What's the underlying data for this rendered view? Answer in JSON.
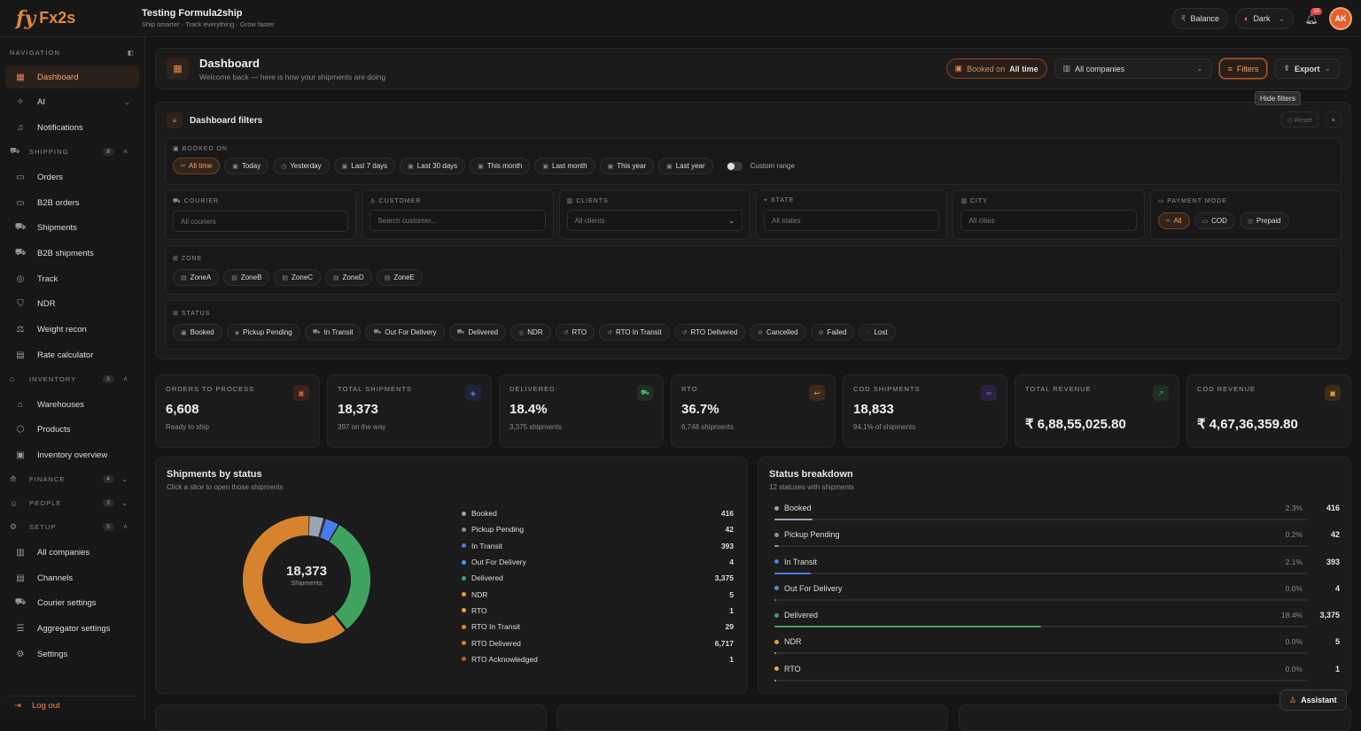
{
  "brand": {
    "logo": "fy",
    "logo2": "Fx2s",
    "title": "Testing Formula2ship",
    "subtitle": "Ship smarter · Track everything · Grow faster"
  },
  "topbar": {
    "balance": "Balance",
    "theme": "Dark",
    "notif_count": "10",
    "avatar": "AK"
  },
  "nav": {
    "header": "NAVIGATION",
    "top": [
      {
        "label": "Dashboard",
        "icon": "dashboard-icon",
        "active": true
      },
      {
        "label": "AI",
        "icon": "ai-icon",
        "chev": "⌄"
      },
      {
        "label": "Notifications",
        "icon": "bell-icon"
      }
    ],
    "shipping": {
      "label": "SHIPPING",
      "count": "8",
      "items": [
        "Orders",
        "B2B orders",
        "Shipments",
        "B2B shipments",
        "Track",
        "NDR",
        "Weight recon",
        "Rate calculator"
      ]
    },
    "inventory": {
      "label": "INVENTORY",
      "count": "3",
      "items": [
        "Warehouses",
        "Products",
        "Inventory overview"
      ]
    },
    "finance": {
      "label": "FINANCE",
      "count": "4"
    },
    "people": {
      "label": "PEOPLE",
      "count": "3"
    },
    "setup": {
      "label": "SETUP",
      "count": "5",
      "items": [
        "All companies",
        "Channels",
        "Courier settings",
        "Aggregator settings",
        "Settings"
      ]
    },
    "logout": "Log out"
  },
  "header": {
    "title": "Dashboard",
    "subtitle": "Welcome back — here is how your shipments are doing",
    "booked_key": "Booked on",
    "booked_val": "All time",
    "companies": "All companies",
    "filters": "Filters",
    "export": "Export",
    "tooltip": "Hide filters"
  },
  "filters": {
    "title": "Dashboard filters",
    "reset": "Reset",
    "booked_label": "BOOKED ON",
    "booked": [
      "All time",
      "Today",
      "Yesterday",
      "Last 7 days",
      "Last 30 days",
      "This month",
      "Last month",
      "This year",
      "Last year"
    ],
    "custom": "Custom range",
    "courier_label": "COURIER",
    "courier_ph": "All couriers",
    "customer_label": "CUSTOMER",
    "customer_ph": "Search customer...",
    "clients_label": "CLIENTS",
    "clients_ph": "All clients",
    "state_label": "STATE",
    "state_ph": "All states",
    "city_label": "CITY",
    "city_ph": "All cities",
    "payment_label": "PAYMENT MODE",
    "payment": [
      "All",
      "COD",
      "Prepaid"
    ],
    "zone_label": "ZONE",
    "zones": [
      "ZoneA",
      "ZoneB",
      "ZoneC",
      "ZoneD",
      "ZoneE"
    ],
    "status_label": "STATUS",
    "statuses": [
      "Booked",
      "Pickup Pending",
      "In Transit",
      "Out For Delivery",
      "Delivered",
      "NDR",
      "RTO",
      "RTO In Transit",
      "RTO Delivered",
      "Cancelled",
      "Failed",
      "Lost"
    ]
  },
  "stats": [
    {
      "label": "ORDERS TO PROCESS",
      "value": "6,608",
      "sub": "Ready to ship",
      "color": "#d45a3a",
      "bg": "#3a221c"
    },
    {
      "label": "TOTAL SHIPMENTS",
      "value": "18,373",
      "sub": "397 on the way",
      "color": "#5b7ee8",
      "bg": "#1e253a"
    },
    {
      "label": "DELIVERED",
      "value": "18.4%",
      "sub": "3,375 shipments",
      "color": "#4caf6a",
      "bg": "#1d2e22"
    },
    {
      "label": "RTO",
      "value": "36.7%",
      "sub": "6,748 shipments",
      "color": "#e0a23a",
      "bg": "#3a2c18"
    },
    {
      "label": "COD SHIPMENTS",
      "value": "18,833",
      "sub": "94.1% of shipments",
      "color": "#9a6ae8",
      "bg": "#2a2140"
    },
    {
      "label": "TOTAL REVENUE",
      "value": "₹ 6,88,55,025.80",
      "sub": "",
      "color": "#4caf6a",
      "bg": "#1d2e22"
    },
    {
      "label": "COD REVENUE",
      "value": "₹ 4,67,36,359.80",
      "sub": "",
      "color": "#e0a23a",
      "bg": "#3a2c18"
    }
  ],
  "donut": {
    "title": "Shipments by status",
    "subtitle": "Click a slice to open those shipments",
    "total": "18,373",
    "total_label": "Shipments"
  },
  "chart_data": {
    "type": "pie",
    "categories": [
      "Booked",
      "Pickup Pending",
      "In Transit",
      "Out For Delivery",
      "Delivered",
      "NDR",
      "RTO",
      "RTO In Transit",
      "RTO Delivered",
      "RTO Acknowledged"
    ],
    "values": [
      416,
      42,
      393,
      4,
      3375,
      5,
      1,
      29,
      6717,
      1
    ],
    "colors": [
      "#9aa3b0",
      "#8a8f99",
      "#4a7be8",
      "#3d9ae0",
      "#3fa35f",
      "#e0a23a",
      "#e8a63a",
      "#d08a30",
      "#d6822f",
      "#c2532c"
    ]
  },
  "breakdown": {
    "title": "Status breakdown",
    "subtitle": "12 statuses with shipments",
    "rows": [
      {
        "label": "Booked",
        "pct": "2.3%",
        "count": "416",
        "color": "#9aa3b0",
        "fill": 0.072
      },
      {
        "label": "Pickup Pending",
        "pct": "0.2%",
        "count": "42",
        "color": "#8a8f99",
        "fill": 0.008
      },
      {
        "label": "In Transit",
        "pct": "2.1%",
        "count": "393",
        "color": "#4a7be8",
        "fill": 0.068
      },
      {
        "label": "Out For Delivery",
        "pct": "0.0%",
        "count": "4",
        "color": "#3d9ae0",
        "fill": 0.002
      },
      {
        "label": "Delivered",
        "pct": "18.4%",
        "count": "3,375",
        "color": "#3fa35f",
        "fill": 0.5
      },
      {
        "label": "NDR",
        "pct": "0.0%",
        "count": "5",
        "color": "#e0a23a",
        "fill": 0.002
      },
      {
        "label": "RTO",
        "pct": "0.0%",
        "count": "1",
        "color": "#e8a63a",
        "fill": 0.002
      }
    ]
  },
  "assistant": "Assistant"
}
